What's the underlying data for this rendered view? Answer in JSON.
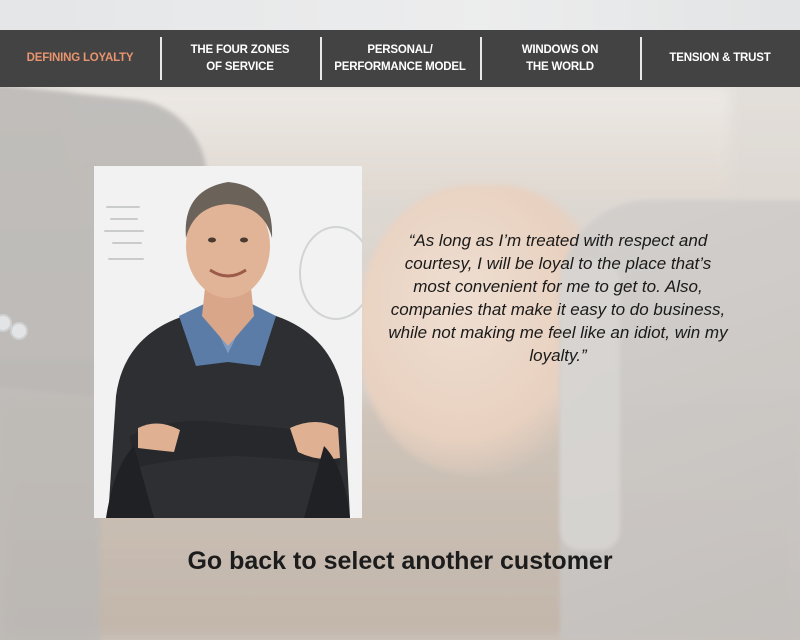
{
  "nav": {
    "items": [
      {
        "label": "DEFINING LOYALTY",
        "active": true
      },
      {
        "label": "THE FOUR ZONES\nOF SERVICE",
        "active": false
      },
      {
        "label": "PERSONAL/\nPERFORMANCE MODEL",
        "active": false
      },
      {
        "label": "WINDOWS ON\nTHE WORLD",
        "active": false
      },
      {
        "label": "TENSION & TRUST",
        "active": false
      }
    ]
  },
  "quote": {
    "text": "“As long as I’m treated with respect and courtesy, I will be loyal to the place that’s most convenient for me to get to. Also, companies that make it easy to do business, while not making me feel like an idiot, win my loyalty.”"
  },
  "back_link": {
    "label": "Go back to select another customer"
  },
  "colors": {
    "nav_bg": "#434343",
    "nav_active": "#e8946f",
    "nav_text": "#ffffff",
    "text_dark": "#1c1c1c"
  },
  "icons": {
    "photo": "customer-portrait-photo",
    "background": "handshake-background-image"
  }
}
